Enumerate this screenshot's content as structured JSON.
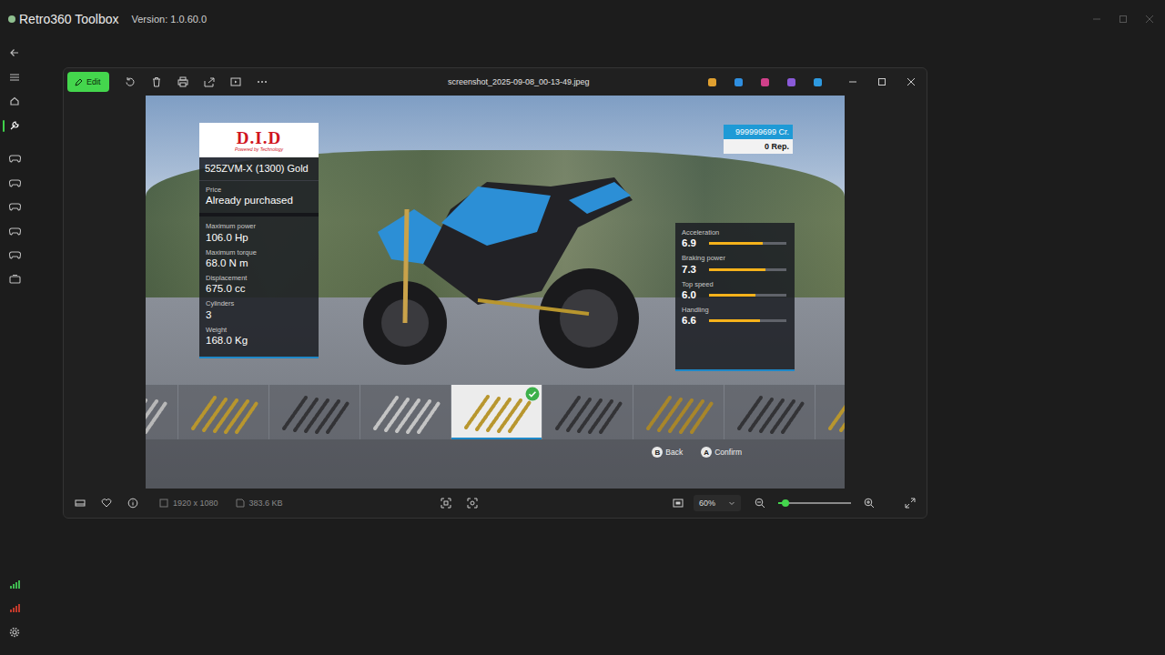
{
  "app": {
    "title": "Retro360 Toolbox",
    "version": "Version: 1.0.60.0"
  },
  "sidebar": {
    "nav": [
      {
        "selected": false
      },
      {
        "selected": false
      },
      {
        "selected": false
      },
      {
        "selected": true
      }
    ],
    "tools": [
      {
        "selected": false
      },
      {
        "selected": false
      },
      {
        "selected": false
      },
      {
        "selected": false
      },
      {
        "selected": false
      },
      {
        "selected": false
      }
    ],
    "status": [
      {
        "color": "#3fb950"
      },
      {
        "color": "#c0392b"
      }
    ]
  },
  "viewer": {
    "title": "screenshot_2025-09-08_00-13-49.jpeg",
    "edit": "Edit",
    "dimensions": "1920 x 1080",
    "file_size": "383.6 KB",
    "zoom": "60%",
    "zoom_level": 0.1
  },
  "game": {
    "brand": {
      "name": "D.I.D",
      "tagline": "Powered by Technology"
    },
    "part_name": "525ZVM-X (1300) Gold",
    "price": {
      "label": "Price",
      "value": "Already purchased"
    },
    "specs": [
      {
        "label": "Maximum power",
        "value": "106.0 Hp"
      },
      {
        "label": "Maximum torque",
        "value": "68.0 N m"
      },
      {
        "label": "Displacement",
        "value": "675.0 cc"
      },
      {
        "label": "Cylinders",
        "value": "3"
      },
      {
        "label": "Weight",
        "value": "168.0 Kg"
      }
    ],
    "ratings": [
      {
        "label": "Acceleration",
        "value": "6.9",
        "level": 0.69
      },
      {
        "label": "Braking power",
        "value": "7.3",
        "level": 0.73
      },
      {
        "label": "Top speed",
        "value": "6.0",
        "level": 0.6
      },
      {
        "label": "Handling",
        "value": "6.6",
        "level": 0.66
      }
    ],
    "credits": "999999699 Cr.",
    "reputation": "0 Rep.",
    "chains": [
      {
        "color": "#b8b8b8",
        "selected": false
      },
      {
        "color": "#b8962e",
        "selected": false
      },
      {
        "color": "#333336",
        "selected": false
      },
      {
        "color": "#c4c4c4",
        "selected": false
      },
      {
        "color": "#b8962e",
        "selected": true
      },
      {
        "color": "#333336",
        "selected": false
      },
      {
        "color": "#a8862a",
        "selected": false
      },
      {
        "color": "#333336",
        "selected": false
      },
      {
        "color": "#b8962e",
        "selected": false
      }
    ],
    "hints": [
      {
        "key": "B",
        "label": "Back"
      },
      {
        "key": "A",
        "label": "Confirm"
      }
    ]
  }
}
